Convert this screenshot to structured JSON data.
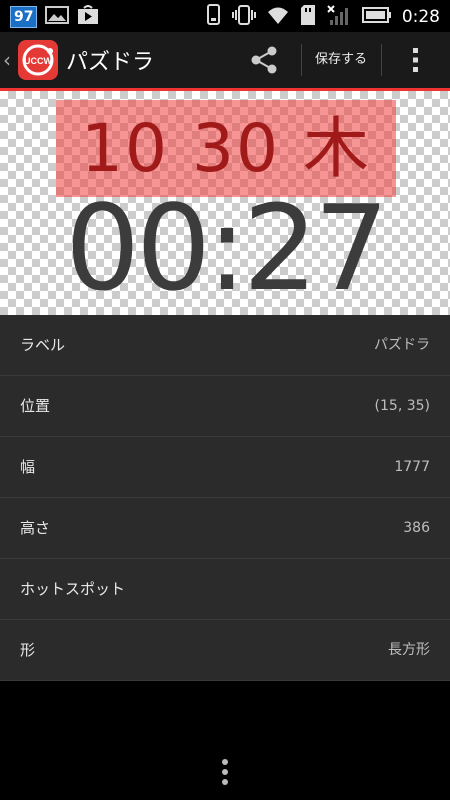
{
  "statusbar": {
    "badge": "97",
    "time": "0:28",
    "icons": [
      "image-icon",
      "play-store-icon",
      "phone-icon",
      "vibrate-icon",
      "wifi-icon",
      "sd-card-icon",
      "signal-icon",
      "battery-icon"
    ]
  },
  "actionbar": {
    "title": "パズドラ",
    "icon_label": "UCCW",
    "save_label": "保存する"
  },
  "preview": {
    "date": "10 30 木",
    "time": "00:27"
  },
  "properties": [
    {
      "label": "ラベル",
      "value": "パズドラ"
    },
    {
      "label": "位置",
      "value": "(15, 35)"
    },
    {
      "label": "幅",
      "value": "1777"
    },
    {
      "label": "高さ",
      "value": "386"
    },
    {
      "label": "ホットスポット",
      "value": ""
    },
    {
      "label": "形",
      "value": "長方形"
    }
  ],
  "colors": {
    "accent": "#e53935",
    "panel": "#2b2b2b",
    "actionbar": "#1a1a1a"
  }
}
